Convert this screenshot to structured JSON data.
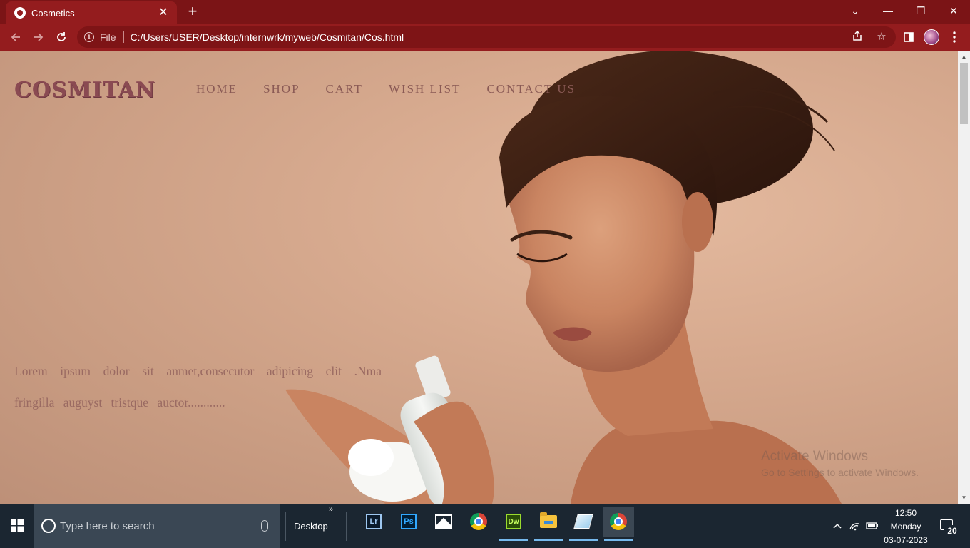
{
  "browser": {
    "tab": {
      "title": "Cosmetics"
    },
    "newtab_label": "+",
    "window_controls": {
      "tabsearch": "⌄",
      "minimize": "—",
      "restore": "❐",
      "close": "✕"
    },
    "omnibox": {
      "scheme_label": "File",
      "url": "C:/Users/USER/Desktop/internwrk/myweb/Cosmitan/Cos.html"
    }
  },
  "site": {
    "logo": "COSMITAN",
    "nav": [
      "HOME",
      "SHOP",
      "CART",
      "WISH LIST",
      "CONTACT US"
    ],
    "hero_text": "Lorem ipsum dolor sit anmet,consecutor adipicing clit .Nma fringilla auguyst tristque auctor............"
  },
  "watermark": {
    "title": "Activate Windows",
    "subtitle": "Go to Settings to activate Windows."
  },
  "taskbar": {
    "search_placeholder": "Type here to search",
    "desktop_label": "Desktop",
    "desktop_chevron": "»",
    "apps": {
      "lightroom_label": "Lr",
      "photoshop_label": "Ps",
      "dreamweaver_label": "Dw"
    },
    "clock": {
      "time": "12:50",
      "day": "Monday",
      "date": "03-07-2023"
    },
    "notification_count": "20"
  },
  "colors": {
    "browser_frame": "#7b1416",
    "browser_toolbar": "#941c1e",
    "logo": "#8a4a52",
    "nav_text": "#8a5a55",
    "page_bg": "#d7aa8f",
    "taskbar": "#1b2631"
  }
}
